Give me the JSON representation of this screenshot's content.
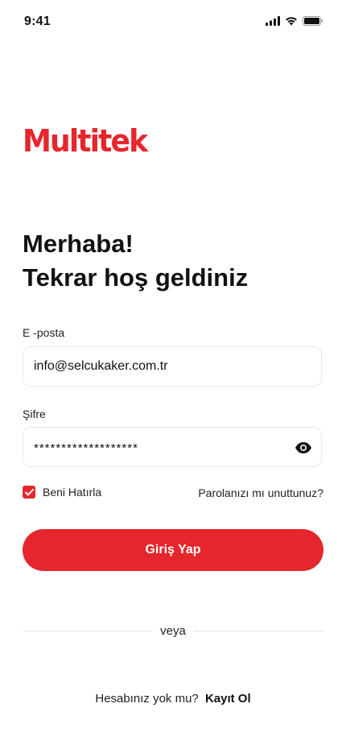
{
  "status_bar": {
    "time": "9:41",
    "icons": [
      "cellular-signal-icon",
      "wifi-icon",
      "battery-icon"
    ]
  },
  "brand": {
    "logo_text": "Multitek",
    "accent_color": "#e5262d"
  },
  "welcome": {
    "line1": "Merhaba!",
    "line2": "Tekrar hoş geldiniz"
  },
  "form": {
    "email_label": "E -posta",
    "email_value": "info@selcukaker.com.tr",
    "password_label": "Şifre",
    "password_value": "*******************",
    "password_toggle_icon": "eye-icon",
    "remember_label": "Beni Hatırla",
    "remember_checked": true,
    "forgot_link": "Parolanızı mı unuttunuz?",
    "submit_label": "Giriş Yap"
  },
  "divider": {
    "text": "veya"
  },
  "signup": {
    "prompt": "Hesabınız yok mu?",
    "link": "Kayıt Ol"
  }
}
